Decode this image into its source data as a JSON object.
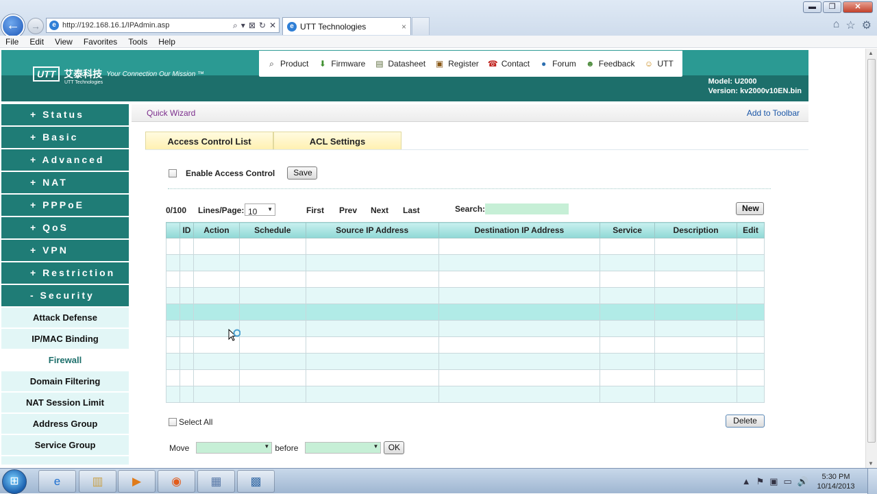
{
  "window": {
    "controls": {
      "minimize": "▬",
      "restore": "❐",
      "close": "✕"
    }
  },
  "browser": {
    "back": "←",
    "forward": "→",
    "url": "http://192.168.16.1/IPAdmin.asp",
    "address_buttons": [
      "⌕",
      "▾",
      "⊠",
      "↻",
      "✕"
    ],
    "tab_title": "UTT Technologies",
    "tab_close": "×",
    "right_icons": {
      "home": "⌂",
      "favorites": "☆",
      "tools": "⚙"
    },
    "menu": [
      "File",
      "Edit",
      "View",
      "Favorites",
      "Tools",
      "Help"
    ]
  },
  "header": {
    "logo_box": "UTT",
    "logo_cn": "艾泰科技",
    "logo_slogan": "Your Connection  Our Mission ™",
    "logo_sub": "UTT Technologies",
    "nav": [
      {
        "label": "Product",
        "icon": "magnifier-icon",
        "glyph": "⌕",
        "color": "#333"
      },
      {
        "label": "Firmware",
        "icon": "download-arrow-icon",
        "glyph": "⬇",
        "color": "#3f8f2f"
      },
      {
        "label": "Datasheet",
        "icon": "book-stack-icon",
        "glyph": "▤",
        "color": "#5a6a3a"
      },
      {
        "label": "Register",
        "icon": "clipboard-icon",
        "glyph": "▣",
        "color": "#8a5a1a"
      },
      {
        "label": "Contact",
        "icon": "telephone-icon",
        "glyph": "☎",
        "color": "#c0241f"
      },
      {
        "label": "Forum",
        "icon": "people-icon",
        "glyph": "●",
        "color": "#2d6fb0"
      },
      {
        "label": "Feedback",
        "icon": "person-feedback-icon",
        "glyph": "☻",
        "color": "#4a8a3a"
      },
      {
        "label": "UTT",
        "icon": "users-icon",
        "glyph": "☺",
        "color": "#c98a1a"
      }
    ],
    "model_label": "Model: U2000",
    "version_label": "Version: kv2000v10EN.bin"
  },
  "sidebar": {
    "sections": [
      {
        "label": "+ Status"
      },
      {
        "label": "+ Basic"
      },
      {
        "label": "+ Advanced"
      },
      {
        "label": "+ NAT"
      },
      {
        "label": "+ PPPoE"
      },
      {
        "label": "+ QoS"
      },
      {
        "label": "+ VPN"
      },
      {
        "label": "+ Restriction"
      },
      {
        "label": "- Security"
      }
    ],
    "sub_items": [
      {
        "label": "Attack Defense"
      },
      {
        "label": "IP/MAC Binding"
      },
      {
        "label": "Firewall",
        "active": true
      },
      {
        "label": "Domain Filtering"
      },
      {
        "label": "NAT Session Limit"
      },
      {
        "label": "Address Group"
      },
      {
        "label": "Service Group"
      }
    ]
  },
  "quickbar": {
    "left": "Quick Wizard",
    "right": "Add to Toolbar"
  },
  "tabs": [
    {
      "label": "Access Control List"
    },
    {
      "label": "ACL Settings"
    }
  ],
  "enable": {
    "label": "Enable Access Control",
    "checked": false,
    "save": "Save"
  },
  "pager": {
    "count": "0/100",
    "lines_label": "Lines/Page:",
    "lines_value": "10",
    "first": "First",
    "prev": "Prev",
    "next": "Next",
    "last": "Last",
    "search_label": "Search:",
    "search_value": "",
    "new": "New"
  },
  "table": {
    "columns": [
      "",
      "ID",
      "Action",
      "Schedule",
      "Source IP Address",
      "Destination IP Address",
      "Service",
      "Description",
      "Edit"
    ],
    "row_count": 10,
    "highlighted_row": 4
  },
  "bottom": {
    "select_all": "Select All",
    "delete": "Delete",
    "move": "Move",
    "before": "before",
    "move_value": "",
    "before_value": "",
    "ok": "OK"
  },
  "taskbar": {
    "start": "⊞",
    "apps": [
      {
        "name": "internet-explorer",
        "glyph": "e",
        "color": "#1e6fd0"
      },
      {
        "name": "file-explorer",
        "glyph": "▥",
        "color": "#c9a24a"
      },
      {
        "name": "media-player",
        "glyph": "▶",
        "color": "#e07b1a"
      },
      {
        "name": "firefox",
        "glyph": "◉",
        "color": "#e35b1a"
      },
      {
        "name": "document-viewer",
        "glyph": "▦",
        "color": "#5a7aa8"
      },
      {
        "name": "network-settings",
        "glyph": "▩",
        "color": "#3a6ea8"
      }
    ],
    "tray": [
      "▲",
      "⚑",
      "▣",
      "▭",
      "🔊"
    ],
    "time": "5:30 PM",
    "date": "10/14/2013"
  }
}
